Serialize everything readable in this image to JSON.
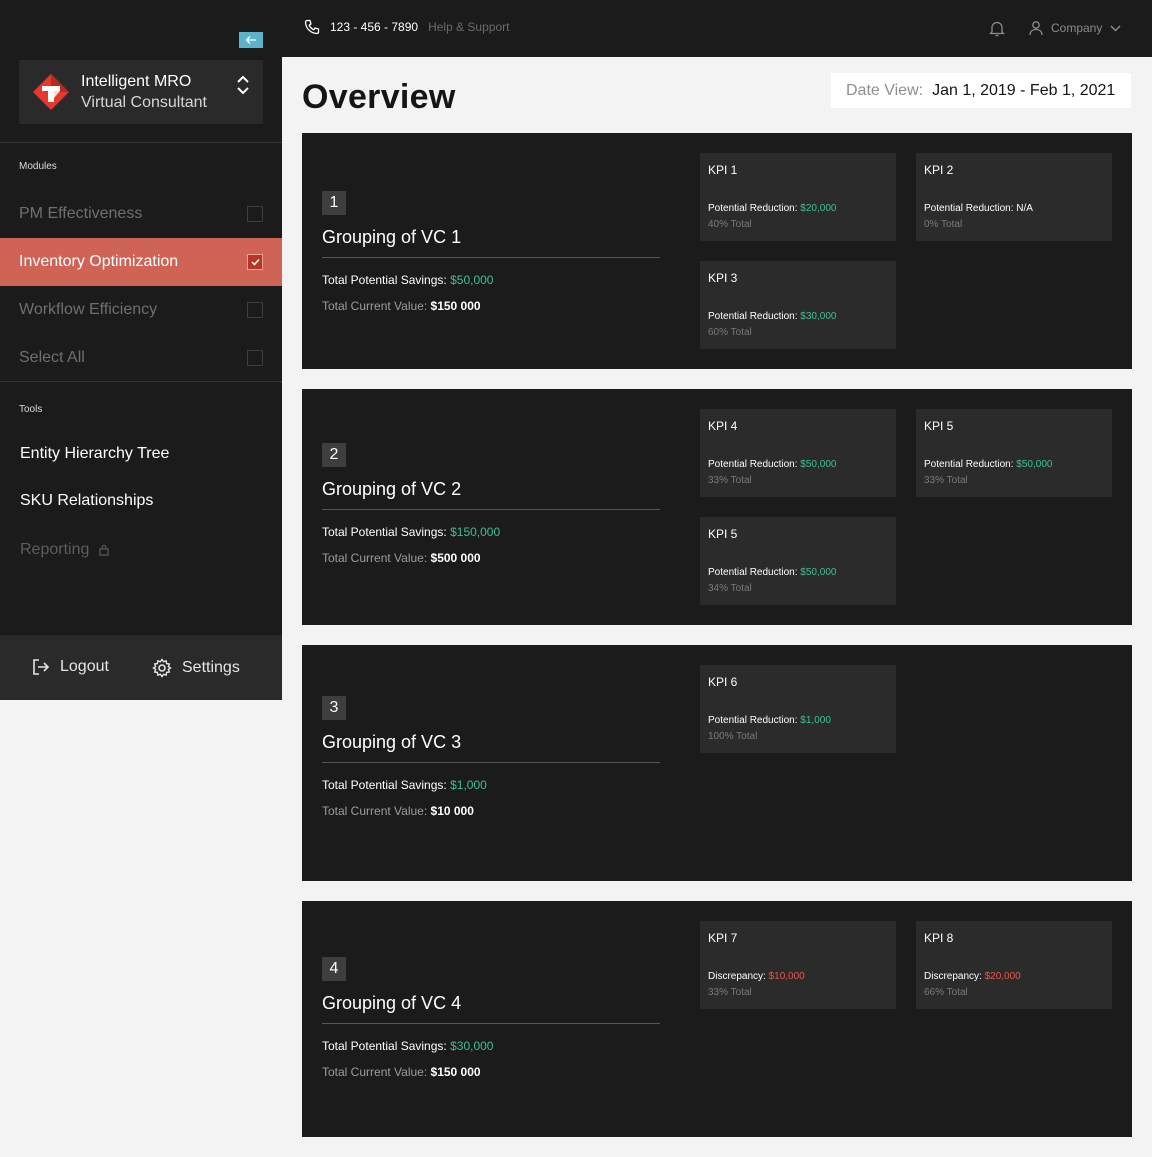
{
  "topbar": {
    "phone": "123 - 456 - 7890",
    "help": "Help & Support",
    "company": "Company"
  },
  "brand": {
    "line1": "Intelligent MRO",
    "line2": "Virtual Consultant"
  },
  "sidebar": {
    "modules_label": "Modules",
    "modules": [
      {
        "label": "PM Effectiveness",
        "checked": false
      },
      {
        "label": "Inventory Optimization",
        "checked": true
      },
      {
        "label": "Workflow Efficiency",
        "checked": false
      },
      {
        "label": "Select All",
        "checked": false
      }
    ],
    "tools_label": "Tools",
    "tools": [
      {
        "label": "Entity Hierarchy Tree"
      },
      {
        "label": "SKU Relationships"
      },
      {
        "label": "Reporting",
        "locked": true
      }
    ],
    "logout": "Logout",
    "settings": "Settings"
  },
  "main": {
    "title": "Overview",
    "date_label": "Date View:",
    "date_value": "Jan 1, 2019 - Feb 1, 2021",
    "savings_label": "Total Potential Savings:",
    "current_label": "Total Current Value:",
    "groups": [
      {
        "num": "1",
        "title": "Grouping of VC 1",
        "savings": "$50,000",
        "current": "$150 000"
      },
      {
        "num": "2",
        "title": "Grouping of VC 2",
        "savings": "$150,000",
        "current": "$500 000"
      },
      {
        "num": "3",
        "title": "Grouping of VC 3",
        "savings": "$1,000",
        "current": "$10 000"
      },
      {
        "num": "4",
        "title": "Grouping of VC 4",
        "savings": "$30,000",
        "current": "$150 000"
      }
    ],
    "kpis": [
      {
        "name": "KPI 1",
        "label": "Potential Reduction:",
        "value": "$20,000",
        "total": "40% Total"
      },
      {
        "name": "KPI 2",
        "label": "Potential Reduction: N/A",
        "value": "",
        "total": "0% Total"
      },
      {
        "name": "KPI 3",
        "label": "Potential Reduction:",
        "value": "$30,000",
        "total": "60% Total"
      },
      {
        "name": "KPI 4",
        "label": "Potential Reduction:",
        "value": "$50,000",
        "total": "33% Total"
      },
      {
        "name": "KPI 5",
        "label": "Potential Reduction:",
        "value": "$50,000",
        "total": "33% Total"
      },
      {
        "name": "KPI 5",
        "label": "Potential Reduction:",
        "value": "$50,000",
        "total": "34% Total"
      },
      {
        "name": "KPI 6",
        "label": "Potential Reduction:",
        "value": "$1,000",
        "total": "100% Total"
      },
      {
        "name": "KPI 7",
        "label": "Discrepancy:",
        "value": "$10,000",
        "total": "33% Total"
      },
      {
        "name": "KPI 8",
        "label": "Discrepancy:",
        "value": "$20,000",
        "total": "66% Total"
      }
    ]
  },
  "colors": {
    "accent": "#cf6456",
    "positive": "#3bc18f",
    "negative": "#e4574d",
    "collapse": "#5bb3c9"
  },
  "icons": [
    "collapse-arrow-icon",
    "logo-icon",
    "chevron-up-icon",
    "chevron-down-icon",
    "check-icon",
    "lock-icon",
    "logout-icon",
    "gear-icon",
    "phone-icon",
    "bell-icon",
    "user-icon"
  ]
}
